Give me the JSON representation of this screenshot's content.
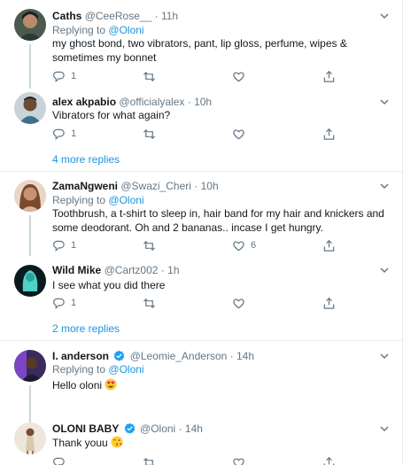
{
  "colors": {
    "link": "#1b95e0",
    "muted": "#657786",
    "line": "#e6ecf0",
    "verified": "#1da1f2"
  },
  "replies": [
    {
      "name": "Caths",
      "handle": "@CeeRose__",
      "time": "11h",
      "replying_label": "Replying to",
      "replying_handle": "@Oloni",
      "text": "my ghost bond, two vibrators, pant, lip gloss, perfume, wipes & sometimes my bonnet",
      "reply_count": "1",
      "retweet_count": "",
      "like_count": ""
    },
    {
      "name": "alex akpabio",
      "handle": "@officialyalex",
      "time": "10h",
      "text": "Vibrators for what again?",
      "reply_count": "1",
      "retweet_count": "",
      "like_count": ""
    },
    {
      "name": "ZamaNgweni",
      "handle": "@Swazi_Cheri",
      "time": "10h",
      "replying_label": "Replying to",
      "replying_handle": "@Oloni",
      "text": "Toothbrush, a t-shirt to sleep in, hair band for my hair and knickers and some deodorant. Oh and 2 bananas.. incase I get hungry.",
      "reply_count": "1",
      "retweet_count": "",
      "like_count": "6"
    },
    {
      "name": "Wild Mike",
      "handle": "@Cartz002",
      "time": "1h",
      "text": "I see what you did there",
      "reply_count": "1",
      "retweet_count": "",
      "like_count": ""
    },
    {
      "name": "I. anderson",
      "verified": true,
      "handle": "@Leomie_Anderson",
      "time": "14h",
      "replying_label": "Replying to",
      "replying_handle": "@Oloni",
      "text": "Hello oloni",
      "emoji": "heart-eyes",
      "reply_count": "",
      "retweet_count": "",
      "like_count": ""
    },
    {
      "name": "OLONI BABY",
      "verified": true,
      "handle": "@Oloni",
      "time": "14h",
      "text": "Thank youu",
      "emoji": "blowing-kiss",
      "reply_count": "",
      "retweet_count": "",
      "like_count": ""
    }
  ],
  "more_replies": [
    "4 more replies",
    "2 more replies"
  ],
  "separator_dot": "·"
}
